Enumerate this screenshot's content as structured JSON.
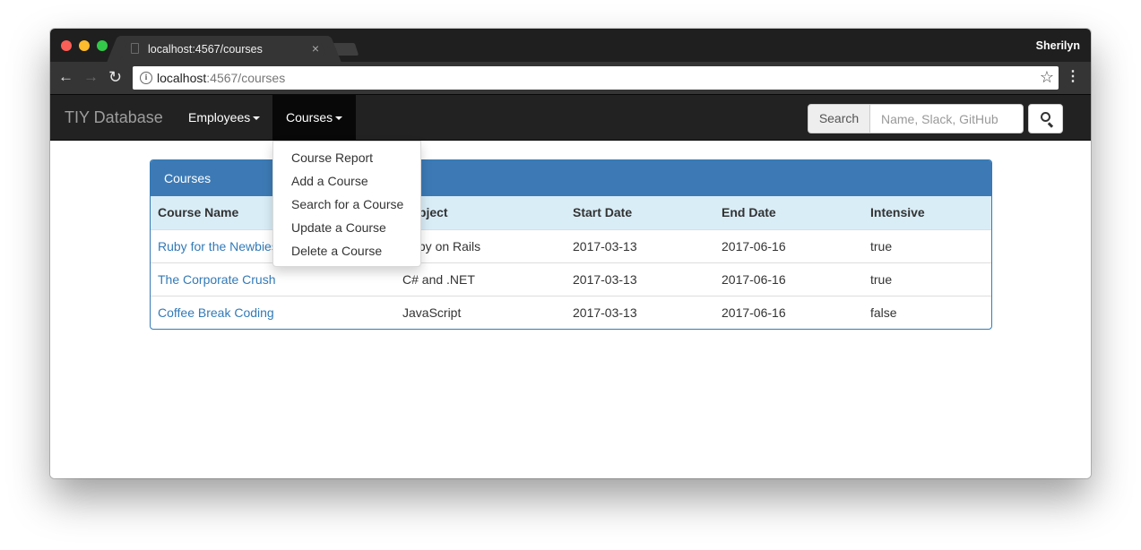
{
  "browser": {
    "tab_title": "localhost:4567/courses",
    "tab_close": "×",
    "profile_name": "Sherilyn",
    "url_host": "localhost",
    "url_rest": ":4567/courses",
    "back_glyph": "←",
    "forward_glyph": "→",
    "reload_glyph": "↻",
    "star_glyph": "☆",
    "menu_glyph": "⋮",
    "info_glyph": "i"
  },
  "navbar": {
    "brand": "TIY Database",
    "items": [
      {
        "label": "Employees"
      },
      {
        "label": "Courses"
      }
    ],
    "search_label": "Search",
    "search_placeholder": "Name, Slack, GitHub",
    "search_value": "",
    "colors": {
      "background": "#222222",
      "active": "#080808"
    }
  },
  "dropdown": {
    "open_menu": "Courses",
    "items": [
      {
        "label": "Course Report"
      },
      {
        "label": "Add a Course"
      },
      {
        "label": "Search for a Course"
      },
      {
        "label": "Update a Course"
      },
      {
        "label": "Delete a Course"
      }
    ]
  },
  "panel": {
    "heading": "Courses",
    "colors": {
      "heading": "#3d7ab5",
      "table_header": "#d9edf7",
      "link": "#337ab7"
    },
    "columns": [
      "Course Name",
      "Subject",
      "Start Date",
      "End Date",
      "Intensive"
    ],
    "rows": [
      {
        "name": "Ruby for the Newbies",
        "subject": "Ruby on Rails",
        "start": "2017-03-13",
        "end": "2017-06-16",
        "intensive": "true"
      },
      {
        "name": "The Corporate Crush",
        "subject": "C# and .NET",
        "start": "2017-03-13",
        "end": "2017-06-16",
        "intensive": "true"
      },
      {
        "name": "Coffee Break Coding",
        "subject": "JavaScript",
        "start": "2017-03-13",
        "end": "2017-06-16",
        "intensive": "false"
      }
    ]
  }
}
